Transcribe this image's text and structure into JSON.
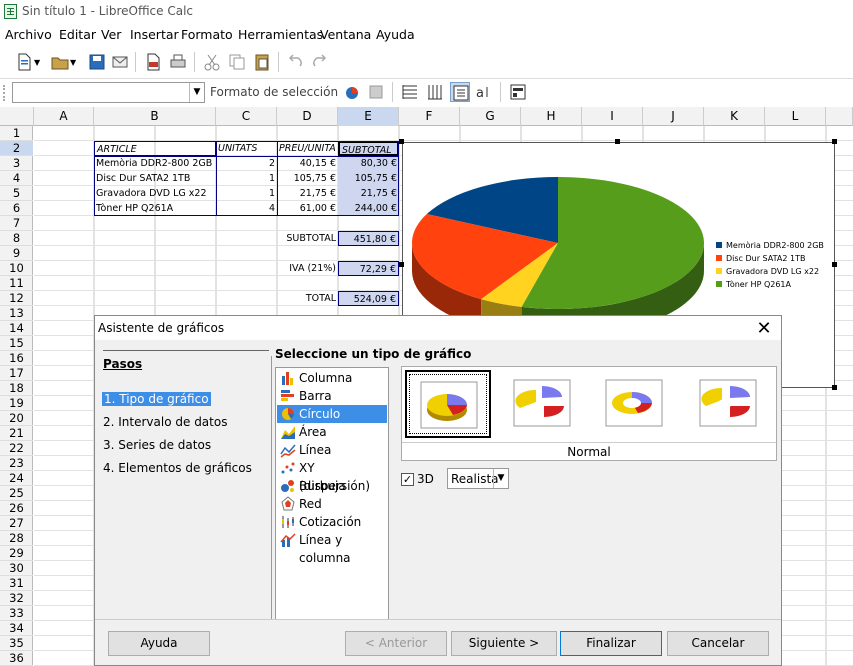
{
  "window": {
    "title": "Sin título 1 - LibreOffice Calc"
  },
  "menu": [
    "Archivo",
    "Editar",
    "Ver",
    "Insertar",
    "Formato",
    "Herramientas",
    "Ventana",
    "Ayuda"
  ],
  "formatbar": {
    "label": "Formato de selección",
    "namebox": ""
  },
  "columns": [
    "A",
    "B",
    "C",
    "D",
    "E",
    "F",
    "G",
    "H",
    "I",
    "J",
    "K",
    "L"
  ],
  "rows": [
    "1",
    "2",
    "3",
    "4",
    "5",
    "6",
    "7",
    "8",
    "9",
    "10",
    "11",
    "12",
    "13",
    "14",
    "15",
    "16",
    "17",
    "18",
    "19",
    "20",
    "21",
    "22",
    "23",
    "24",
    "25",
    "26",
    "27",
    "28",
    "29",
    "30",
    "31",
    "32",
    "33",
    "34",
    "35",
    "36"
  ],
  "sheet": {
    "headers": {
      "article": "ARTICLE",
      "units": "UNITATS",
      "price": "PREU/UNITA",
      "subtotal": "SUBTOTAL"
    },
    "items": [
      {
        "name": "Memòria DDR2-800 2GB",
        "units": "2",
        "price": "40,15 €",
        "subtotal": "80,30 €"
      },
      {
        "name": "Disc Dur SATA2 1TB",
        "units": "1",
        "price": "105,75 €",
        "subtotal": "105,75 €"
      },
      {
        "name": "Gravadora DVD LG x22",
        "units": "1",
        "price": "21,75 €",
        "subtotal": "21,75 €"
      },
      {
        "name": "Tòner HP Q261A",
        "units": "4",
        "price": "61,00 €",
        "subtotal": "244,00 €"
      }
    ],
    "subtotal_label": "SUBTOTAL",
    "subtotal_value": "451,80 €",
    "iva_label": "IVA (21%)",
    "iva_value": "72,29 €",
    "total_label": "TOTAL",
    "total_value": "524,09 €"
  },
  "chart_data": {
    "type": "pie",
    "categories": [
      "Memòria DDR2-800 2GB",
      "Disc Dur SATA2 1TB",
      "Gravadora DVD LG x22",
      "Tòner HP Q261A"
    ],
    "values": [
      80.3,
      105.75,
      21.75,
      244.0
    ],
    "colors": [
      "#004586",
      "#ff420e",
      "#ffd320",
      "#579d1c"
    ],
    "legend_position": "right",
    "three_d": true
  },
  "dialog": {
    "title": "Asistente de gráficos",
    "steps_heading": "Pasos",
    "steps": [
      "1. Tipo de gráfico",
      "2. Intervalo de datos",
      "3. Series de datos",
      "4. Elementos de gráficos"
    ],
    "select_heading": "Seleccione un tipo de gráfico",
    "types": [
      "Columna",
      "Barra",
      "Círculo",
      "Área",
      "Línea",
      "XY (dispersión)",
      "Burbuja",
      "Red",
      "Cotización",
      "Línea y columna"
    ],
    "selected_type": "Círculo",
    "variant_name": "Normal",
    "three_d_label": "3D",
    "three_d_checked": "✓",
    "shape": "Realista",
    "buttons": {
      "help": "Ayuda",
      "back": "< Anterior",
      "next": "Siguiente >",
      "finish": "Finalizar",
      "cancel": "Cancelar"
    }
  }
}
